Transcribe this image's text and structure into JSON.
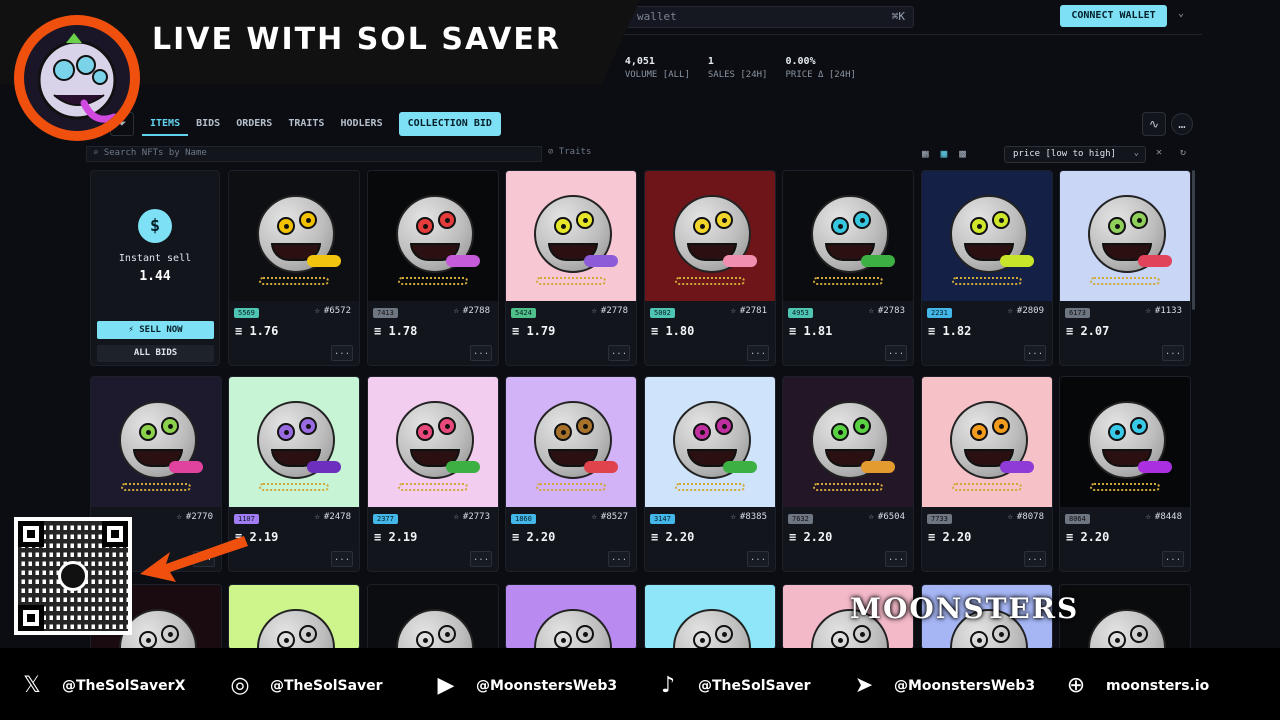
{
  "banner": {
    "title": "LIVE WITH SOL SAVER"
  },
  "header": {
    "wallet_search_placeholder": "wallet",
    "shortcut": "⌘K",
    "connect_label": "CONNECT WALLET"
  },
  "stats": [
    {
      "value": "",
      "label": "H]"
    },
    {
      "value": "4,051",
      "label": "VOLUME [ALL]"
    },
    {
      "value": "1",
      "label": "SALES [24H]"
    },
    {
      "value": "0.00%",
      "label": "PRICE Δ [24H]"
    }
  ],
  "tabs": [
    "ITEMS",
    "BIDS",
    "ORDERS",
    "TRAITS",
    "HODLERS"
  ],
  "collection_bid_label": "COLLECTION BID",
  "filters": {
    "search_placeholder": "Search NFTs by Name",
    "traits_label": "Traits",
    "sort_value": "price [low to high]"
  },
  "instant_sell": {
    "label": "Instant sell",
    "value": "1.44",
    "sell_now": "⚡ SELL NOW",
    "all_bids": "ALL BIDS"
  },
  "cards_row1": [
    {
      "rank": "5569",
      "rank_color": "teal",
      "id": "#6572",
      "price": "≡ 1.76",
      "bg": "#0e0f12",
      "eye": "#f2c200",
      "tongue": "#f1c40f"
    },
    {
      "rank": "7413",
      "rank_color": "gray",
      "id": "#2788",
      "price": "≡ 1.78",
      "bg": "#08090b",
      "eye": "#e53b3b",
      "tongue": "#c55bd8"
    },
    {
      "rank": "5424",
      "rank_color": "green",
      "id": "#2778",
      "price": "≡ 1.79",
      "bg": "#f7c8d4",
      "eye": "#e6e62a",
      "tongue": "#8e5bd8"
    },
    {
      "rank": "5002",
      "rank_color": "teal",
      "id": "#2781",
      "price": "≡ 1.80",
      "bg": "#6d1518",
      "eye": "#f2d52a",
      "tongue": "#f08fb0"
    },
    {
      "rank": "4953",
      "rank_color": "teal",
      "id": "#2783",
      "price": "≡ 1.81",
      "bg": "#0b0c0f",
      "eye": "#36c6e0",
      "tongue": "#3cb043"
    },
    {
      "rank": "2231",
      "rank_color": "blue",
      "id": "#2809",
      "price": "≡ 1.82",
      "bg": "#142046",
      "eye": "#cfe62a",
      "tongue": "#c9e52a"
    },
    {
      "rank": "6173",
      "rank_color": "gray",
      "id": "#1133",
      "price": "≡ 2.07",
      "bg": "#c9d6f6",
      "eye": "#8fcf5a",
      "tongue": "#e0435a"
    }
  ],
  "cards_row2": [
    {
      "rank": "",
      "rank_color": "blue",
      "id": "#2770",
      "price": "",
      "bg": "#1d1a2d",
      "eye": "#8bd14b",
      "tongue": "#e0439e"
    },
    {
      "rank": "1107",
      "rank_color": "purple",
      "id": "#2478",
      "price": "≡ 2.19",
      "bg": "#c8f4d6",
      "eye": "#9a6be0",
      "tongue": "#6c2fbe"
    },
    {
      "rank": "2377",
      "rank_color": "blue",
      "id": "#2773",
      "price": "≡ 2.19",
      "bg": "#f3cdf0",
      "eye": "#e7497a",
      "tongue": "#3cb043"
    },
    {
      "rank": "1860",
      "rank_color": "blue",
      "id": "#8527",
      "price": "≡ 2.20",
      "bg": "#d3b3f7",
      "eye": "#a9722b",
      "tongue": "#e0434b"
    },
    {
      "rank": "3147",
      "rank_color": "blue",
      "id": "#8385",
      "price": "≡ 2.20",
      "bg": "#cfe3fb",
      "eye": "#c02fa0",
      "tongue": "#3cb043"
    },
    {
      "rank": "7632",
      "rank_color": "gray",
      "id": "#6504",
      "price": "≡ 2.20",
      "bg": "#231626",
      "eye": "#5ad043",
      "tongue": "#e39a2f"
    },
    {
      "rank": "7733",
      "rank_color": "gray",
      "id": "#8078",
      "price": "≡ 2.20",
      "bg": "#f6c2c7",
      "eye": "#f29b1c",
      "tongue": "#8e3bd8"
    },
    {
      "rank": "8064",
      "rank_color": "gray",
      "id": "#8448",
      "price": "≡ 2.20",
      "bg": "#060708",
      "eye": "#39c9e8",
      "tongue": "#aa2fe0"
    }
  ],
  "cards_row3_bgs": [
    "#1a0b10",
    "#cdf58c",
    "#0c0d10",
    "#b98af0",
    "#8ee6f8",
    "#f3b9c9",
    "#a6b6f5",
    "#0a0b0d"
  ],
  "moonsters_logo": "MOONSTERS",
  "social": [
    {
      "icon": "x-icon",
      "glyph": "𝕏",
      "handle": "@TheSolSaverX"
    },
    {
      "icon": "instagram-icon",
      "glyph": "◎",
      "handle": "@TheSolSaver"
    },
    {
      "icon": "youtube-icon",
      "glyph": "▶",
      "handle": "@MoonstersWeb3"
    },
    {
      "icon": "tiktok-icon",
      "glyph": "♪",
      "handle": "@TheSolSaver"
    },
    {
      "icon": "telegram-icon",
      "glyph": "➤",
      "handle": "@MoonstersWeb3"
    },
    {
      "icon": "globe-icon",
      "glyph": "⊕",
      "handle": "moonsters.io"
    }
  ]
}
